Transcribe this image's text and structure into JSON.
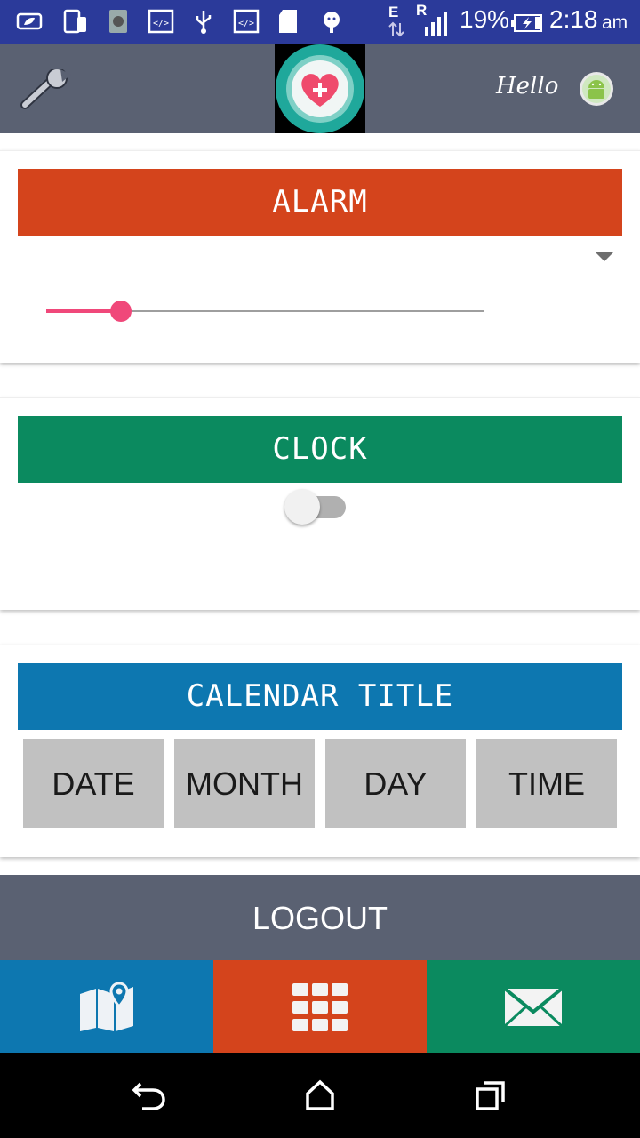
{
  "status_bar": {
    "battery_percent": "19%",
    "time": "2:18",
    "ampm": "am",
    "network_e": "E",
    "network_r": "R"
  },
  "app_bar": {
    "greeting": "Hello"
  },
  "alarm": {
    "title": "ALARM",
    "slider_value": 0.17
  },
  "clock": {
    "title": "CLOCK",
    "toggle_on": false
  },
  "calendar": {
    "title": "CALENDAR TITLE",
    "cells": [
      "DATE",
      "MONTH",
      "DAY",
      "TIME"
    ]
  },
  "logout_label": "LOGOUT",
  "colors": {
    "status_bar": "#2b3a9a",
    "app_bar": "#5a6172",
    "alarm": "#d4441c",
    "clock": "#0b8a5f",
    "calendar": "#0d77b0",
    "slider_accent": "#f0487a"
  },
  "bottom_bar": [
    {
      "icon": "map-icon"
    },
    {
      "icon": "grid-apps-icon"
    },
    {
      "icon": "mail-icon"
    }
  ]
}
